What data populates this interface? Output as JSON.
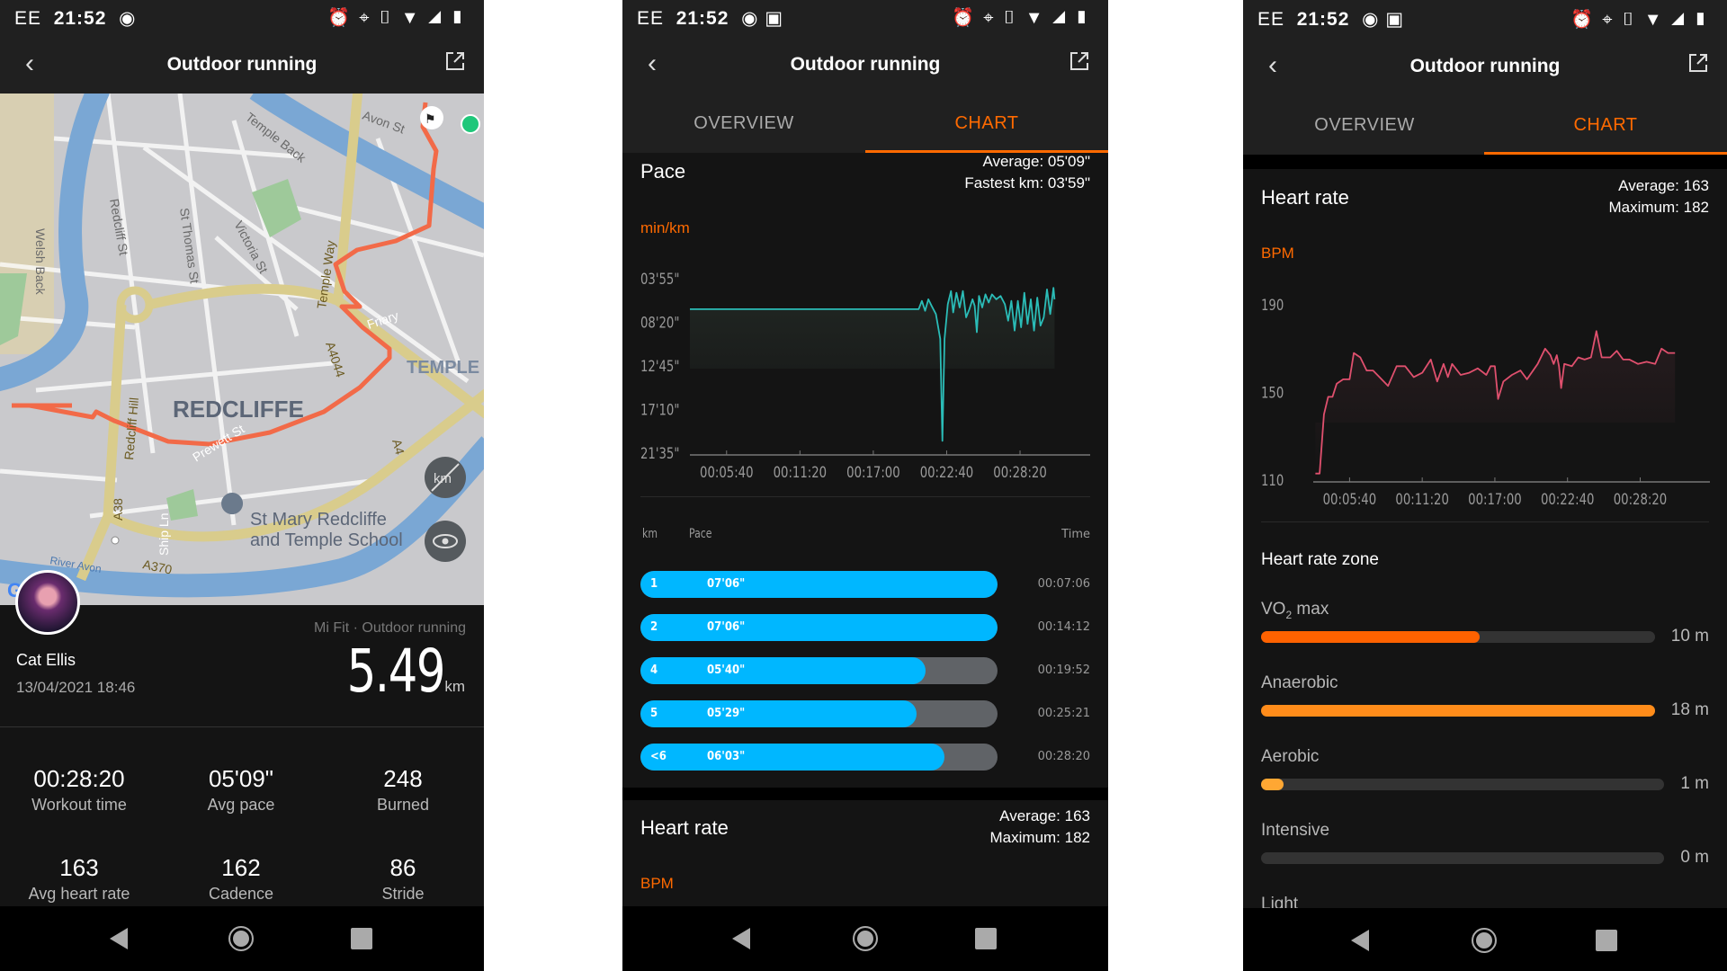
{
  "status_bar": {
    "carrier": "EE",
    "time": "21:52",
    "icons": [
      "play-circle-icon",
      "image-icon",
      "alarm-icon",
      "location-icon",
      "vibrate-icon",
      "data-arrows-icon",
      "wifi-icon",
      "signal-icon",
      "battery-icon"
    ]
  },
  "colors": {
    "accent": "#ff6a00",
    "pace_line": "#2bbdb8",
    "heart_line": "#e0506e",
    "split_bar": "#00b7ff",
    "zone_vo2": "#ff6200",
    "zone_anaerobic": "#ff8c1a",
    "zone_aerobic": "#ffa733"
  },
  "overview": {
    "title": "Outdoor running",
    "map": {
      "labels": {
        "temple_back": "Temple Back",
        "avon_st": "Avon St",
        "redcliff_st": "Redcliff St",
        "st_thomas_st": "St Thomas St",
        "victoria_st": "Victoria St",
        "welsh_back": "Welsh Back",
        "temple_way": "Temple Way",
        "friary": "Friary",
        "a4044": "A4044",
        "temple": "TEMPLE",
        "redcliffe": "REDCLIFFE",
        "redcliff_hill": "Redcliff Hill",
        "prewett_st": "Prewett St",
        "a38": "A38",
        "ship_ln": "Ship Ln",
        "a4": "A4",
        "school_1": "St Mary Redcliffe",
        "school_2": "and Temple School",
        "river_avon": "River Avon",
        "a370": "A370"
      },
      "logo": "Google"
    },
    "user": {
      "name": "Cat Ellis",
      "datetime": "13/04/2021 18:46"
    },
    "source": "Mi Fit · Outdoor running",
    "distance": "5.49",
    "distance_unit": "km",
    "stats": [
      {
        "value": "00:28:20",
        "label": "Workout time"
      },
      {
        "value": "05'09\"",
        "label": "Avg pace"
      },
      {
        "value": "248",
        "label": "Burned"
      },
      {
        "value": "163",
        "label": "Avg heart rate"
      },
      {
        "value": "162",
        "label": "Cadence"
      },
      {
        "value": "86",
        "label": "Stride"
      }
    ]
  },
  "tabs": [
    {
      "label": "OVERVIEW"
    },
    {
      "label": "CHART"
    }
  ],
  "pace": {
    "title": "Pace",
    "average": "Average: 05'09\"",
    "fastest": "Fastest km: 03'59\"",
    "unit": "min/km",
    "table_headers": {
      "km": "km",
      "pace": "Pace",
      "time": "Time"
    },
    "splits": [
      {
        "km": "1",
        "pace": "07'06\"",
        "time": "00:07:06"
      },
      {
        "km": "2",
        "pace": "07'06\"",
        "time": "00:14:12"
      },
      {
        "km": "4",
        "pace": "05'40\"",
        "time": "00:19:52"
      },
      {
        "km": "5",
        "pace": "05'29\"",
        "time": "00:25:21"
      },
      {
        "km": "<6",
        "pace": "06'03\"",
        "time": "00:28:20"
      }
    ]
  },
  "heart_rate": {
    "title": "Heart rate",
    "average": "Average: 163",
    "maximum": "Maximum: 182",
    "unit": "BPM"
  },
  "zones": {
    "title": "Heart rate zone",
    "items": [
      {
        "label": "VO",
        "sub": "2",
        "suffix": " max",
        "minutes": 10,
        "value": "10 m"
      },
      {
        "label": "Anaerobic",
        "minutes": 18,
        "value": "18 m"
      },
      {
        "label": "Aerobic",
        "minutes": 1,
        "value": "1 m"
      },
      {
        "label": "Intensive",
        "minutes": 0,
        "value": "0 m"
      },
      {
        "label": "Light"
      }
    ]
  },
  "chart_data": [
    {
      "type": "line",
      "name": "pace",
      "ylabel": "min/km",
      "x_ticks": [
        "00:05:40",
        "00:11:20",
        "00:17:00",
        "00:22:40",
        "00:28:20"
      ],
      "y_ticks": [
        "03'55\"",
        "08'20\"",
        "12'45\"",
        "17'10\"",
        "21'35\""
      ],
      "y_reversed": true,
      "xlim": [
        "00:02:50",
        "00:31:40"
      ],
      "ylim": [
        "03'55\"",
        "21'35\""
      ],
      "grid": false,
      "points": [
        [
          "00:02:50",
          "07'00\""
        ],
        [
          "00:20:30",
          "07'00\""
        ],
        [
          "00:20:45",
          "06'10\""
        ],
        [
          "00:21:00",
          "07'10\""
        ],
        [
          "00:21:15",
          "06'00\""
        ],
        [
          "00:21:30",
          "06'40\""
        ],
        [
          "00:21:50",
          "07'30\""
        ],
        [
          "00:22:10",
          "10'00\""
        ],
        [
          "00:22:20",
          "20'20\""
        ],
        [
          "00:22:30",
          "10'00\""
        ],
        [
          "00:22:45",
          "06'30\""
        ],
        [
          "00:23:00",
          "05'10\""
        ],
        [
          "00:23:10",
          "07'20\""
        ],
        [
          "00:23:25",
          "05'20\""
        ],
        [
          "00:23:40",
          "06'50\""
        ],
        [
          "00:23:55",
          "05'10\""
        ],
        [
          "00:24:10",
          "07'50\""
        ],
        [
          "00:24:25",
          "07'00\""
        ],
        [
          "00:24:40",
          "06'00\""
        ],
        [
          "00:24:50",
          "06'40\""
        ],
        [
          "00:25:00",
          "09'20\""
        ],
        [
          "00:25:10",
          "05'40\""
        ],
        [
          "00:25:25",
          "06'50\""
        ],
        [
          "00:25:40",
          "05'30\""
        ],
        [
          "00:25:55",
          "06'20\""
        ],
        [
          "00:26:10",
          "05'30\""
        ],
        [
          "00:26:30",
          "06'00\""
        ],
        [
          "00:26:50",
          "05'40\""
        ],
        [
          "00:27:10",
          "06'30\""
        ],
        [
          "00:27:25",
          "08'10\""
        ],
        [
          "00:27:40",
          "06'10\""
        ],
        [
          "00:27:55",
          "09'10\""
        ],
        [
          "00:28:10",
          "06'10\""
        ],
        [
          "00:28:25",
          "08'50\""
        ],
        [
          "00:28:40",
          "05'20\""
        ],
        [
          "00:28:55",
          "08'30\""
        ],
        [
          "00:29:10",
          "06'00\""
        ],
        [
          "00:29:25",
          "09'10\""
        ],
        [
          "00:29:40",
          "05'50\""
        ],
        [
          "00:29:55",
          "08'40\""
        ],
        [
          "00:30:10",
          "07'50\""
        ],
        [
          "00:30:25",
          "05'00\""
        ],
        [
          "00:30:40",
          "07'30\""
        ],
        [
          "00:30:55",
          "04'50\""
        ],
        [
          "00:31:00",
          "06'00\""
        ]
      ]
    },
    {
      "type": "line",
      "name": "heart_rate",
      "ylabel": "BPM",
      "x_ticks": [
        "00:05:40",
        "00:11:20",
        "00:17:00",
        "00:22:40",
        "00:28:20"
      ],
      "y_ticks": [
        "190",
        "150",
        "110"
      ],
      "xlim": [
        "00:02:50",
        "00:31:40"
      ],
      "ylim": [
        110,
        190
      ],
      "grid": false,
      "points": [
        [
          "00:03:00",
          113
        ],
        [
          "00:03:20",
          113
        ],
        [
          "00:03:40",
          140
        ],
        [
          "00:04:00",
          148
        ],
        [
          "00:04:20",
          148
        ],
        [
          "00:04:40",
          154
        ],
        [
          "00:05:10",
          156
        ],
        [
          "00:05:40",
          156
        ],
        [
          "00:06:00",
          168
        ],
        [
          "00:06:30",
          166
        ],
        [
          "00:07:00",
          160
        ],
        [
          "00:07:30",
          160
        ],
        [
          "00:08:00",
          157
        ],
        [
          "00:08:40",
          153
        ],
        [
          "00:09:20",
          162
        ],
        [
          "00:10:00",
          162
        ],
        [
          "00:10:40",
          157
        ],
        [
          "00:11:20",
          159
        ],
        [
          "00:12:00",
          165
        ],
        [
          "00:12:30",
          155
        ],
        [
          "00:13:00",
          163
        ],
        [
          "00:13:20",
          157
        ],
        [
          "00:13:40",
          163
        ],
        [
          "00:14:20",
          158
        ],
        [
          "00:15:00",
          159
        ],
        [
          "00:15:40",
          161
        ],
        [
          "00:16:20",
          158
        ],
        [
          "00:16:40",
          162
        ],
        [
          "00:17:00",
          162
        ],
        [
          "00:17:15",
          147
        ],
        [
          "00:17:40",
          155
        ],
        [
          "00:18:20",
          158
        ],
        [
          "00:19:00",
          160
        ],
        [
          "00:19:30",
          156
        ],
        [
          "00:20:20",
          163
        ],
        [
          "00:20:55",
          170
        ],
        [
          "00:21:20",
          167
        ],
        [
          "00:21:35",
          163
        ],
        [
          "00:21:50",
          167
        ],
        [
          "00:22:00",
          162
        ],
        [
          "00:22:10",
          152
        ],
        [
          "00:22:25",
          163
        ],
        [
          "00:23:00",
          162
        ],
        [
          "00:23:30",
          166
        ],
        [
          "00:24:00",
          165
        ],
        [
          "00:24:30",
          166
        ],
        [
          "00:24:55",
          178
        ],
        [
          "00:25:20",
          166
        ],
        [
          "00:26:00",
          166
        ],
        [
          "00:26:30",
          169
        ],
        [
          "00:27:00",
          165
        ],
        [
          "00:27:30",
          165
        ],
        [
          "00:28:10",
          163
        ],
        [
          "00:28:50",
          164
        ],
        [
          "00:29:30",
          163
        ],
        [
          "00:30:00",
          170
        ],
        [
          "00:30:30",
          168
        ],
        [
          "00:31:03",
          168
        ]
      ]
    }
  ]
}
